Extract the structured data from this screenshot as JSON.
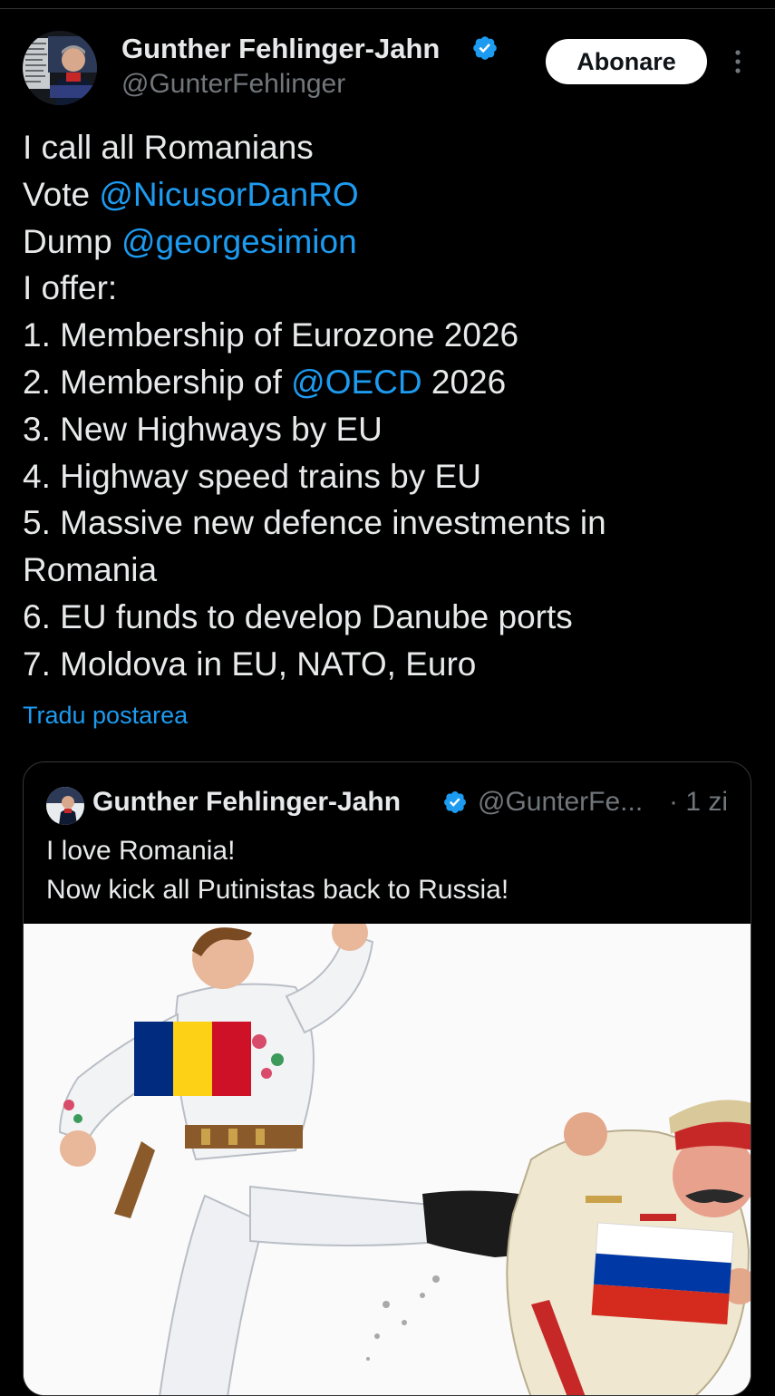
{
  "post": {
    "author_name": "Gunther Fehlinger-Jahn",
    "author_handle": "@GunterFehlinger",
    "follow_label": "Abonare",
    "more_icon": "more-vertical-icon",
    "verified_icon": "verified-badge-icon",
    "accent": "#1d9bf0",
    "lines": [
      {
        "text": "I call all Romanians"
      },
      {
        "prefix": "Vote ",
        "mention": "@NicusorDanRO"
      },
      {
        "prefix": "Dump ",
        "mention": "@georgesimion"
      },
      {
        "text": "I offer:"
      },
      {
        "text": "1. Membership of Eurozone 2026"
      },
      {
        "prefix": "2. Membership of ",
        "mention": "@OECD",
        "suffix": " 2026"
      },
      {
        "text": "3. New Highways by EU"
      },
      {
        "text": "4. Highway speed trains by EU"
      },
      {
        "text": "5. Massive new defence investments in Romania"
      },
      {
        "text": "6. EU funds to develop Danube ports"
      },
      {
        "text": "7. Moldova in EU, NATO, Euro"
      }
    ],
    "translate_label": "Tradu postarea"
  },
  "quote": {
    "author_name": "Gunther Fehlinger-Jahn",
    "author_handle": "@GunterFe...",
    "time": "· 1 zi",
    "text_lines": [
      "I love Romania!",
      "Now kick all Putinistas back to Russia!"
    ],
    "image": {
      "flag_romania": [
        "#002b7f",
        "#fcd116",
        "#ce1126"
      ],
      "flag_russia": [
        "#ffffff",
        "#0039a6",
        "#d52b1e"
      ]
    }
  }
}
